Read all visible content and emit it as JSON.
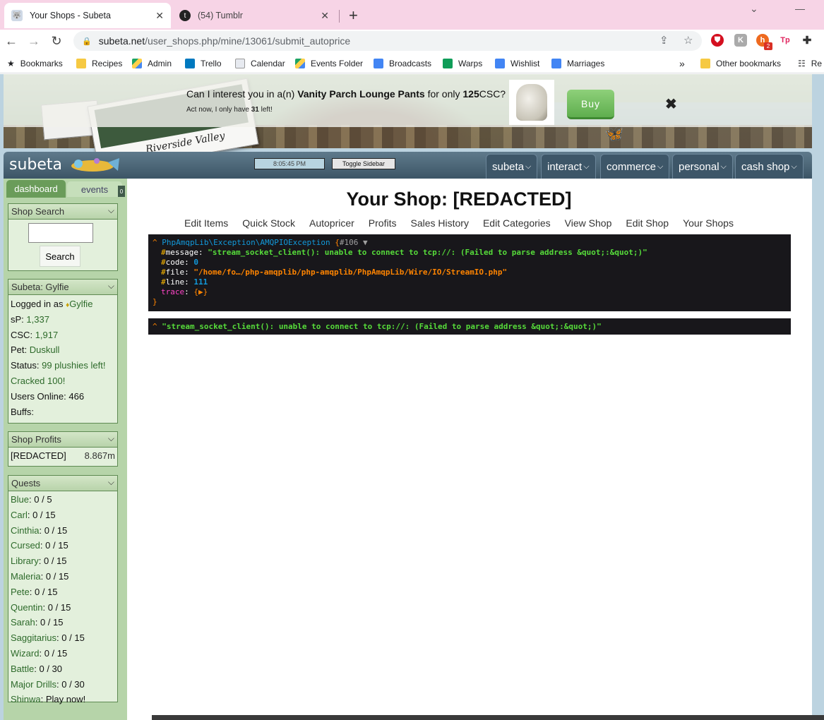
{
  "browser": {
    "tabs": [
      {
        "title": "Your Shops - Subeta",
        "active": true
      },
      {
        "title": "(54) Tumblr",
        "active": false
      }
    ],
    "url_host": "subeta.net",
    "url_path": "/user_shops.php/mine/13061/submit_autoprice",
    "extension_badge": "2",
    "bookmarks": [
      "Bookmarks",
      "Recipes",
      "Admin",
      "Trello",
      "Calendar",
      "Events Folder",
      "Broadcasts",
      "Warps",
      "Wishlist",
      "Marriages"
    ],
    "overflow": "»",
    "other_bookmarks": "Other bookmarks",
    "reading_list": "Re"
  },
  "ad": {
    "prefix": "Can I interest you in a(n) ",
    "item": "Vanity Parch Lounge Pants",
    "middle": " for only ",
    "price": "125",
    "currency": "CSC?",
    "sub_prefix": "Act now, I only have ",
    "sub_count": "31",
    "sub_suffix": " left!",
    "buy_label": "Buy",
    "close": "✖"
  },
  "banner": {
    "caption": "Riverside Valley"
  },
  "site": {
    "logo": "subeta",
    "clock": "8:05:45 PM",
    "toggle_sidebar": "Toggle Sidebar",
    "menus": [
      "subeta",
      "interact",
      "commerce",
      "personal",
      "cash shop"
    ]
  },
  "sidebar": {
    "tab_dashboard": "dashboard",
    "tab_events": "events",
    "events_badge": "0",
    "shop_search": {
      "title": "Shop Search",
      "button": "Search"
    },
    "user": {
      "title": "Subeta: Gylfie",
      "logged_in_label": "Logged in as",
      "username": "Gylfie",
      "sp_label": "sP:",
      "sp_value": "1,337",
      "csc_label": "CSC:",
      "csc_value": "1,917",
      "pet_label": "Pet:",
      "pet_value": "Duskull",
      "status_label": "Status:",
      "status_value": "99 plushies left!",
      "cracked": "Cracked 100!",
      "online_label": "Users Online:",
      "online_value": "466",
      "buffs_label": "Buffs:"
    },
    "profits": {
      "title": "Shop Profits",
      "shop": "[REDACTED]",
      "value": "8.867m"
    },
    "quests": {
      "title": "Quests",
      "items": [
        {
          "name": "Blue",
          "value": "0 / 5"
        },
        {
          "name": "Carl",
          "value": "0 / 15"
        },
        {
          "name": "Cinthia",
          "value": "0 / 15"
        },
        {
          "name": "Cursed",
          "value": "0 / 15"
        },
        {
          "name": "Library",
          "value": "0 / 15"
        },
        {
          "name": "Maleria",
          "value": "0 / 15"
        },
        {
          "name": "Pete",
          "value": "0 / 15"
        },
        {
          "name": "Quentin",
          "value": "0 / 15"
        },
        {
          "name": "Sarah",
          "value": "0 / 15"
        },
        {
          "name": "Saggitarius",
          "value": "0 / 15"
        },
        {
          "name": "Wizard",
          "value": "0 / 15"
        },
        {
          "name": "Battle",
          "value": "0 / 30"
        },
        {
          "name": "Major Drills",
          "value": "0 / 30"
        },
        {
          "name": "Shinwa",
          "value": "Play now!"
        }
      ]
    }
  },
  "main": {
    "title": "Your Shop: [REDACTED]",
    "nav": [
      "Edit Items",
      "Quick Stock",
      "Autopricer",
      "Profits",
      "Sales History",
      "Edit Categories",
      "View Shop",
      "Edit Shop",
      "Your Shops"
    ],
    "dump1": {
      "caret": "^",
      "class": "PhpAmqpLib\\Exception\\AMQPIOException",
      "open": "{",
      "ref": "#106 ▼",
      "message_key": "message",
      "message_value": "\"stream_socket_client(): unable to connect to tcp://: (Failed to parse address &quot;:&quot;)\"",
      "code_key": "code",
      "code_value": "0",
      "file_key": "file",
      "file_value": "\"/home/fo…/php-amqplib/php-amqplib/PhpAmqpLib/Wire/IO/StreamIO.php\"",
      "line_key": "line",
      "line_value": "111",
      "trace_key": "trace",
      "trace_value": "{▶}",
      "close": "}"
    },
    "dump2": {
      "caret": "^",
      "value": "\"stream_socket_client(): unable to connect to tcp://: (Failed to parse address &quot;:&quot;)\""
    }
  },
  "colors": {
    "tab_strip": "#f7d4e6",
    "sidebar_bg": "#b6d4a9",
    "site_bar": "#3c5566",
    "buy": "#6fbd5c",
    "dump_bg": "#18171b",
    "dump_string": "#56db3a"
  }
}
